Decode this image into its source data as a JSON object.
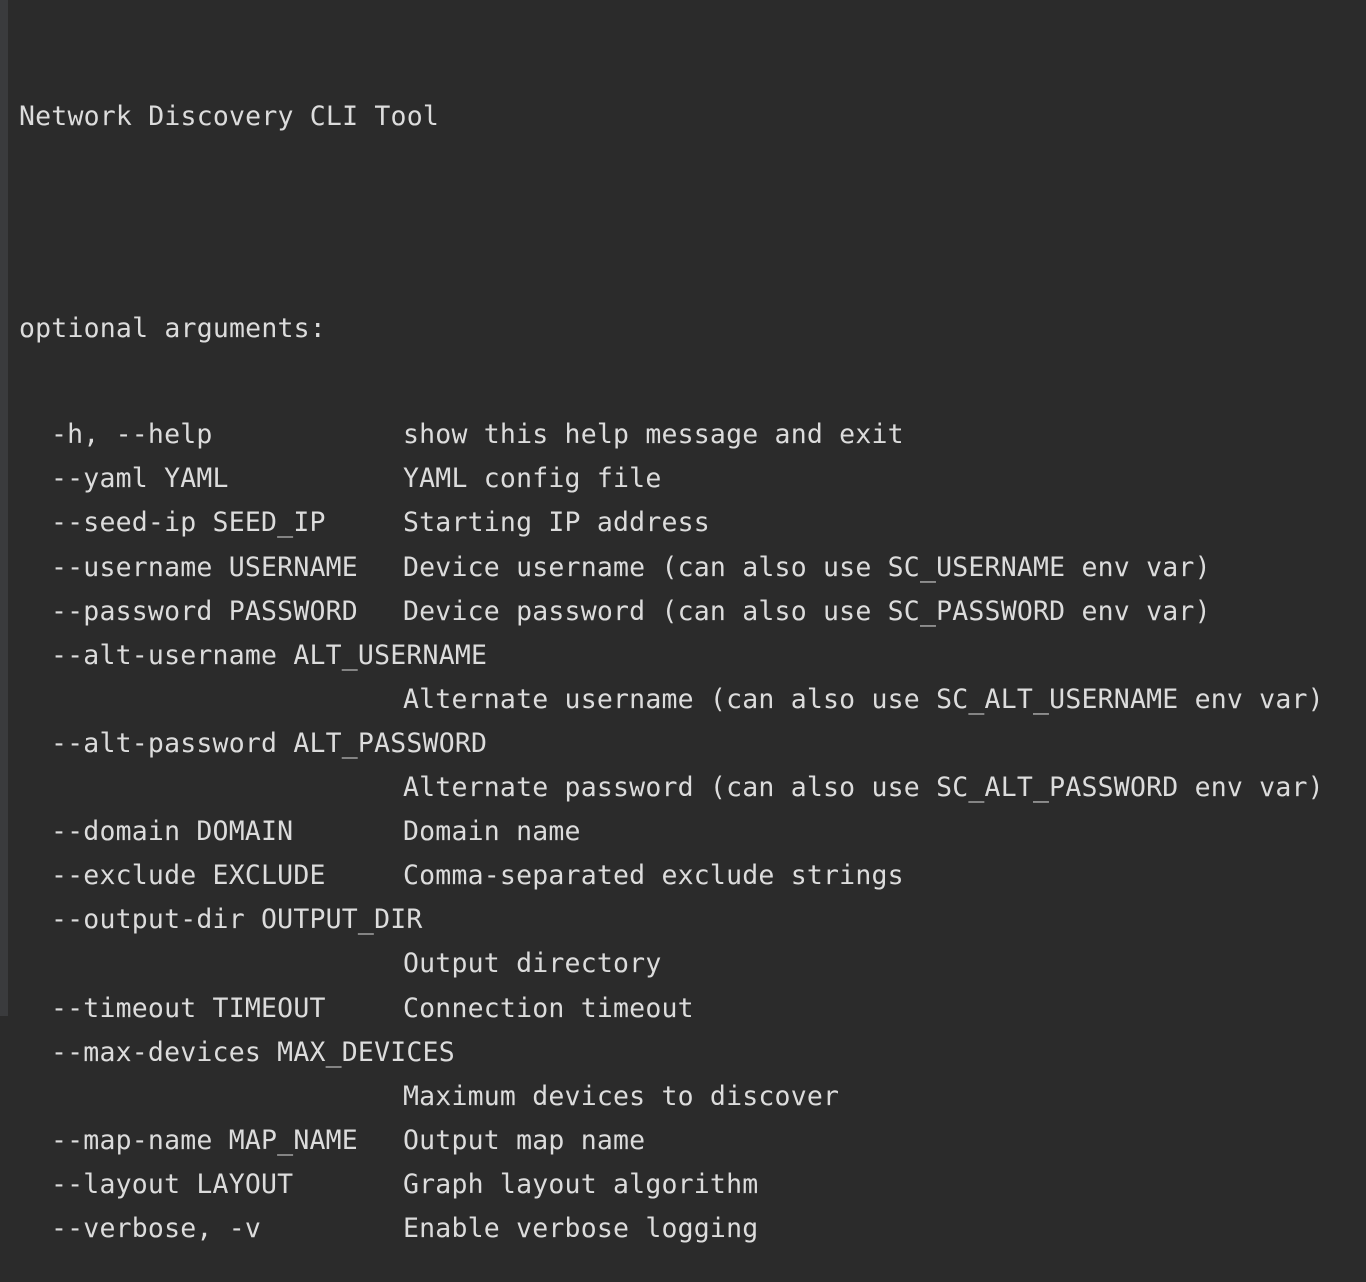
{
  "terminal": {
    "description": "Network Discovery CLI Tool",
    "section_header": "optional arguments:",
    "options": [
      {
        "flag": "-h, --help",
        "help": "show this help message and exit",
        "wrap": false
      },
      {
        "flag": "--yaml YAML",
        "help": "YAML config file",
        "wrap": false
      },
      {
        "flag": "--seed-ip SEED_IP",
        "help": "Starting IP address",
        "wrap": false
      },
      {
        "flag": "--username USERNAME",
        "help": "Device username (can also use SC_USERNAME env var)",
        "wrap": false
      },
      {
        "flag": "--password PASSWORD",
        "help": "Device password (can also use SC_PASSWORD env var)",
        "wrap": false
      },
      {
        "flag": "--alt-username ALT_USERNAME",
        "help": "Alternate username (can also use SC_ALT_USERNAME env var)",
        "wrap": true
      },
      {
        "flag": "--alt-password ALT_PASSWORD",
        "help": "Alternate password (can also use SC_ALT_PASSWORD env var)",
        "wrap": true
      },
      {
        "flag": "--domain DOMAIN",
        "help": "Domain name",
        "wrap": false
      },
      {
        "flag": "--exclude EXCLUDE",
        "help": "Comma-separated exclude strings",
        "wrap": false
      },
      {
        "flag": "--output-dir OUTPUT_DIR",
        "help": "Output directory",
        "wrap": true
      },
      {
        "flag": "--timeout TIMEOUT",
        "help": "Connection timeout",
        "wrap": false
      },
      {
        "flag": "--max-devices MAX_DEVICES",
        "help": "Maximum devices to discover",
        "wrap": true
      },
      {
        "flag": "--map-name MAP_NAME",
        "help": "Output map name",
        "wrap": false
      },
      {
        "flag": "--layout LAYOUT",
        "help": "Graph layout algorithm",
        "wrap": false
      },
      {
        "flag": "--verbose, -v",
        "help": "Enable verbose logging",
        "wrap": false
      }
    ]
  }
}
